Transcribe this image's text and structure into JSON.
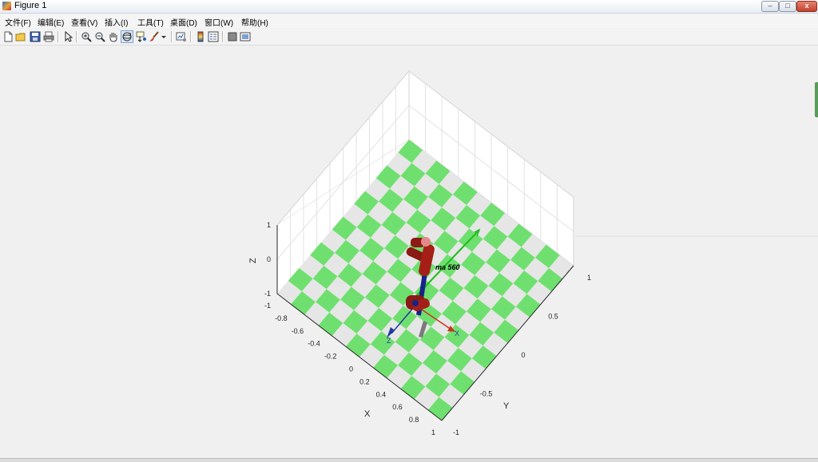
{
  "window": {
    "title": "Figure 1",
    "controls": {
      "minimize": "–",
      "restore": "□",
      "close": "x"
    }
  },
  "menu": [
    "文件(F)",
    "编辑(E)",
    "查看(V)",
    "插入(I)",
    "工具(T)",
    "桌面(D)",
    "窗口(W)",
    "帮助(H)"
  ],
  "toolbar": {
    "buttons": [
      "new-figure-icon",
      "open-file-icon",
      "save-icon",
      "print-icon",
      "edit-plot-pointer-icon",
      "zoom-in-icon",
      "zoom-out-icon",
      "pan-hand-icon",
      "rotate-3d-icon",
      "data-cursor-icon",
      "brush-icon",
      "brush-dropdown-icon",
      "link-plot-icon",
      "insert-colorbar-icon",
      "insert-legend-icon",
      "hide-plot-tools-icon",
      "show-plot-tools-icon"
    ],
    "pressed": "rotate-3d-icon"
  },
  "plot": {
    "axes": {
      "x_label": "X",
      "y_label": "Y",
      "z_label": "Z",
      "x_ticks": [
        "-1",
        "-0.8",
        "-0.6",
        "-0.4",
        "-0.2",
        "0",
        "0.2",
        "0.4",
        "0.6",
        "0.8",
        "1"
      ],
      "y_ticks": [
        "1",
        "0.5",
        "0",
        "-0.5",
        "-1"
      ],
      "z_ticks": [
        "1",
        "0",
        "-1"
      ],
      "x_range": [
        -1,
        1
      ],
      "y_range": [
        -1,
        1
      ],
      "z_range": [
        -1,
        1
      ]
    },
    "floor": {
      "pattern": "checkerboard",
      "colors": {
        "green": "#6fe06f",
        "gray": "#e6e6e6"
      }
    },
    "robot": {
      "name_label": "ma 560",
      "link_color": "#8b1a14",
      "joint_color": "#16238a",
      "frame": {
        "x_axis": {
          "label": "X",
          "color": "#c8351e"
        },
        "z_axis": {
          "label": "Z",
          "color": "#1f3aa0"
        },
        "y_axis_color": "#1ebd1e"
      }
    }
  }
}
